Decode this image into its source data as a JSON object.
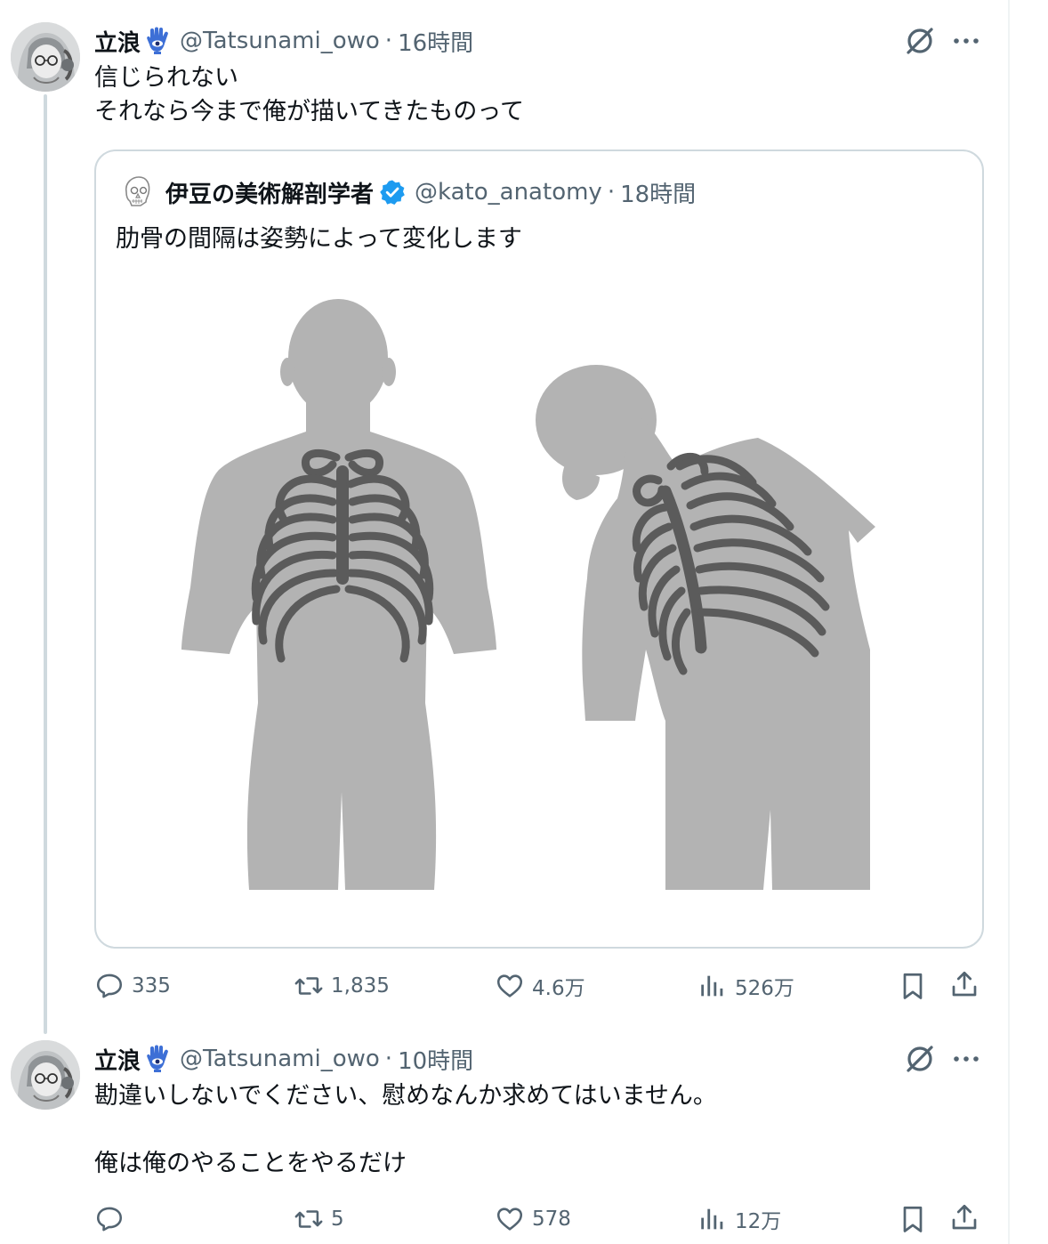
{
  "tweets": [
    {
      "display_name": "立浪",
      "handle": "@Tatsunami_owo",
      "separator": "·",
      "time": "16時間",
      "text_lines": [
        "信じられない",
        "それなら今まで俺が描いてきたものって"
      ],
      "avatar_icon": "anime-girl-sketch-avatar",
      "badge_icon": "hamsa-hand-icon",
      "quote": {
        "display_name": "伊豆の美術解剖学者",
        "handle": "@kato_anatomy",
        "separator": "·",
        "time": "18時間",
        "text": "肋骨の間隔は姿勢によって変化します",
        "avatar_icon": "skull-sketch-avatar",
        "verified_icon": "verified-badge-icon",
        "image_subject": "two back-view torso silhouettes with rib cages, upright and bent forward"
      },
      "actions": {
        "replies": "335",
        "retweets": "1,835",
        "likes": "4.6万",
        "views": "526万"
      }
    },
    {
      "display_name": "立浪",
      "handle": "@Tatsunami_owo",
      "separator": "·",
      "time": "10時間",
      "text_lines": [
        "勘違いしないでください、慰めなんか求めてはいません。",
        "",
        "俺は俺のやることをやるだけ"
      ],
      "avatar_icon": "anime-girl-sketch-avatar",
      "badge_icon": "hamsa-hand-icon",
      "actions": {
        "replies": "",
        "retweets": "5",
        "likes": "578",
        "views": "12万"
      }
    }
  ],
  "colors": {
    "text_primary": "#0f1419",
    "text_secondary": "#536471",
    "border": "#cfd9de",
    "verified_blue": "#1d9bf0",
    "silhouette": "#b3b3b3",
    "ribs": "#5b5b5b"
  }
}
